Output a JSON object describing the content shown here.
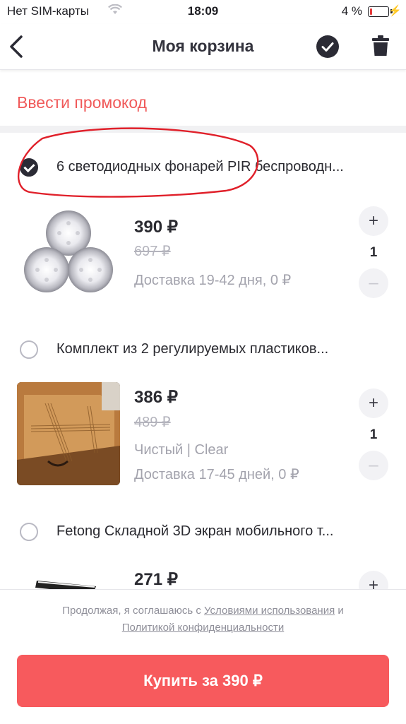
{
  "status_bar": {
    "carrier": "Нет SIM-карты",
    "time": "18:09",
    "battery": "4 %"
  },
  "nav": {
    "title": "Моя корзина",
    "icons": [
      "back-arrow-icon",
      "check-circle-icon",
      "trash-icon"
    ]
  },
  "promo": {
    "label": "Ввести промокод"
  },
  "items": [
    {
      "title": "6 светодиодных фонарей PIR беспроводн...",
      "selected": true,
      "price": "390 ₽",
      "old_price": "697 ₽",
      "variant": "",
      "delivery": "Доставка 19-42 дня, 0 ₽",
      "qty": "1"
    },
    {
      "title": "Комплект из 2 регулируемых пластиков...",
      "selected": false,
      "price": "386 ₽",
      "old_price": "489 ₽",
      "variant": "Чистый | Clear",
      "delivery": "Доставка 17-45 дней, 0 ₽",
      "qty": "1"
    },
    {
      "title": "Fetong Складной 3D экран мобильного т...",
      "selected": false,
      "price": "271 ₽",
      "old_price": "",
      "variant": "",
      "delivery": "",
      "qty": ""
    }
  ],
  "stepper": {
    "plus": "+",
    "minus": "–"
  },
  "footer": {
    "terms_prefix": "Продолжая, я соглашаюсь с ",
    "terms_link": "Условиями использования",
    "terms_and": " и",
    "privacy_link": "Политикой конфиденциальности",
    "buy_label": "Купить за 390 ₽"
  },
  "colors": {
    "accent": "#f75a5d",
    "promo": "#f05a5a",
    "annotation": "#e0202a"
  }
}
